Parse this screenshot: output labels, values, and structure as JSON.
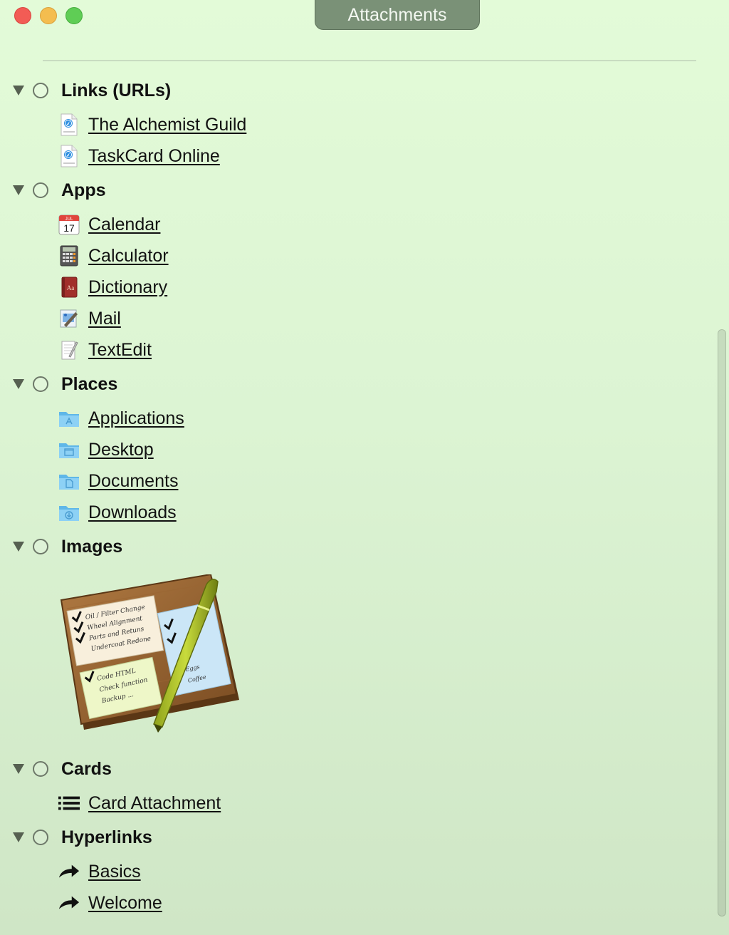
{
  "window": {
    "title": "Attachments"
  },
  "sections": {
    "links": {
      "title": "Links (URLs)",
      "items": [
        "The Alchemist Guild",
        "TaskCard Online"
      ]
    },
    "apps": {
      "title": "Apps",
      "items": [
        "Calendar",
        "Calculator",
        "Dictionary",
        "Mail",
        "TextEdit"
      ]
    },
    "places": {
      "title": "Places",
      "items": [
        "Applications",
        "Desktop",
        "Documents",
        "Downloads"
      ]
    },
    "images": {
      "title": "Images"
    },
    "cards": {
      "title": "Cards",
      "items": [
        "Card Attachment"
      ]
    },
    "hyperlinks": {
      "title": "Hyperlinks",
      "items": [
        "Basics",
        "Welcome"
      ]
    }
  },
  "calendar_icon": {
    "month": "JUL",
    "day": "17"
  },
  "image_notes": {
    "note1": [
      "Oil / Filter Change",
      "Wheel Alignment",
      "Parts and Retuns",
      "Undercoat Redone"
    ],
    "note2": [
      "Code HTML",
      "Check function",
      "Backup ..."
    ],
    "note3": [
      "Eggs",
      "Coffee"
    ]
  },
  "colors": {
    "background": "#e3fbd8",
    "title_tab": "#7a9177",
    "folder": "#6cc3ee"
  }
}
